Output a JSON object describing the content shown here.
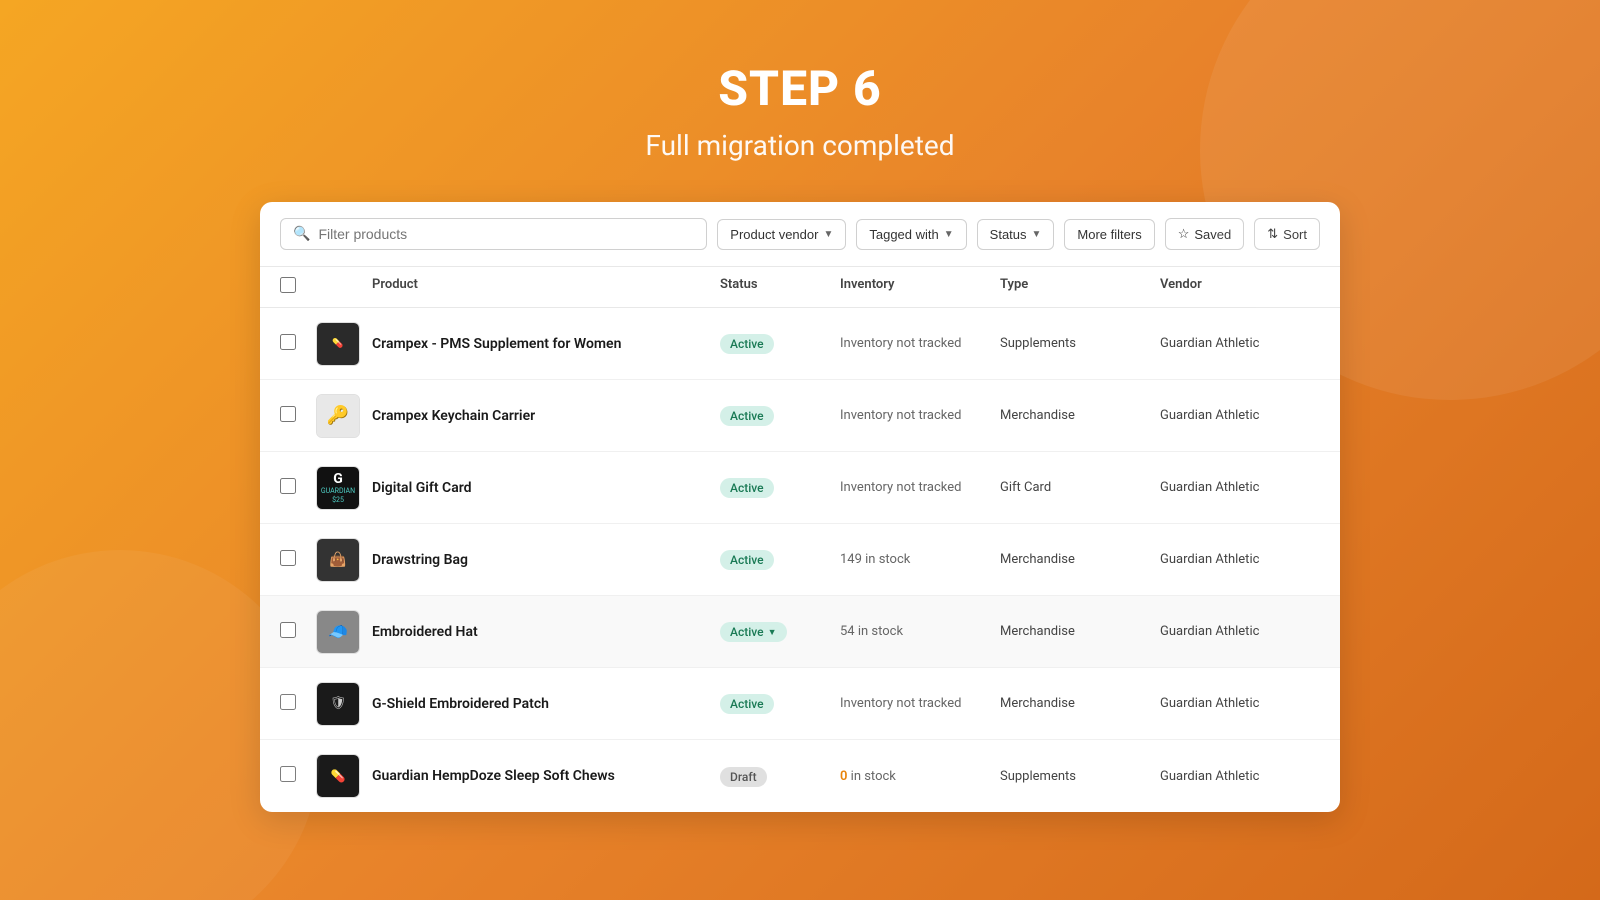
{
  "hero": {
    "step_label": "STEP 6",
    "subtitle": "Full migration completed"
  },
  "toolbar": {
    "search_placeholder": "Filter products",
    "filter1_label": "Product vendor",
    "filter2_label": "Tagged with",
    "filter3_label": "Status",
    "filter4_label": "More filters",
    "saved_label": "Saved",
    "sort_label": "Sort"
  },
  "table": {
    "columns": [
      "Product",
      "Status",
      "Inventory",
      "Type",
      "Vendor"
    ],
    "rows": [
      {
        "name": "Crampex - PMS Supplement for Women",
        "status": "Active",
        "status_type": "active",
        "inventory": "Inventory not tracked",
        "inventory_type": "normal",
        "type": "Supplements",
        "vendor": "Guardian Athletic",
        "thumb_type": "supplement"
      },
      {
        "name": "Crampex Keychain Carrier",
        "status": "Active",
        "status_type": "active",
        "inventory": "Inventory not tracked",
        "inventory_type": "normal",
        "type": "Merchandise",
        "vendor": "Guardian Athletic",
        "thumb_type": "keychain"
      },
      {
        "name": "Digital Gift Card",
        "status": "Active",
        "status_type": "active",
        "inventory": "Inventory not tracked",
        "inventory_type": "normal",
        "type": "Gift Card",
        "vendor": "Guardian Athletic",
        "thumb_type": "giftcard"
      },
      {
        "name": "Drawstring Bag",
        "status": "Active",
        "status_type": "active",
        "inventory": "149 in stock",
        "inventory_type": "normal",
        "type": "Merchandise",
        "vendor": "Guardian Athletic",
        "thumb_type": "bag"
      },
      {
        "name": "Embroidered Hat",
        "status": "Active",
        "status_type": "active_arrow",
        "inventory": "54 in stock",
        "inventory_type": "normal",
        "type": "Merchandise",
        "vendor": "Guardian Athletic",
        "thumb_type": "hat"
      },
      {
        "name": "G-Shield Embroidered Patch",
        "status": "Active",
        "status_type": "active",
        "inventory": "Inventory not tracked",
        "inventory_type": "normal",
        "type": "Merchandise",
        "vendor": "Guardian Athletic",
        "thumb_type": "patch"
      },
      {
        "name": "Guardian HempDoze Sleep Soft Chews",
        "status": "Draft",
        "status_type": "draft",
        "inventory": "0 in stock",
        "inventory_type": "zero",
        "type": "Supplements",
        "vendor": "Guardian Athletic",
        "thumb_type": "hemp"
      }
    ]
  },
  "colors": {
    "accent": "#f5a623",
    "active_badge_bg": "#d4f0e8",
    "active_badge_text": "#1a7a55",
    "draft_badge_bg": "#e0e0e0",
    "draft_badge_text": "#555555"
  }
}
